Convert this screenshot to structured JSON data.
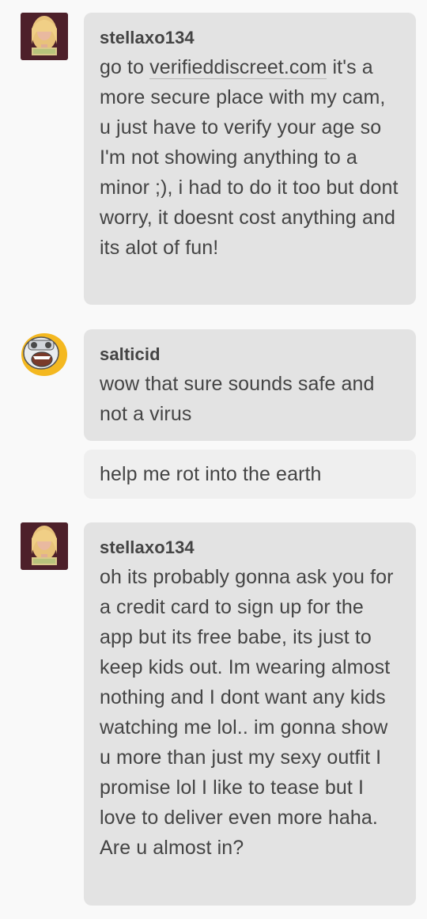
{
  "messages": [
    {
      "username": "stellaxo134",
      "avatar_icon": "user-photo-avatar-icon",
      "text_before_link": "go to ",
      "link_text": "verifieddiscreet.com",
      "text_after_link": " it's a more secure place with my cam, u just have to verify your age so I'm not showing anything to a minor ;), i had to do it too but dont worry, it doesnt cost anything and its alot of fun!"
    },
    {
      "username": "salticid",
      "avatar_icon": "yellow-cartoon-face-avatar-icon",
      "text": "wow that sure sounds safe and not a virus"
    },
    {
      "text": "help me rot into the earth"
    },
    {
      "username": "stellaxo134",
      "avatar_icon": "user-photo-avatar-icon",
      "text": "oh its probably gonna ask you for a credit card to sign up for the app but its free babe,  its just to keep kids out. Im wearing almost nothing and I dont want any kids watching me lol.. im gonna show u more than just my sexy outfit I promise lol  I like to tease but I love to deliver even more haha. Are u almost in?"
    }
  ],
  "colors": {
    "background": "#f9f9f9",
    "bubble_dark": "#e3e3e3",
    "bubble_light": "#efefef",
    "text": "#444444"
  }
}
